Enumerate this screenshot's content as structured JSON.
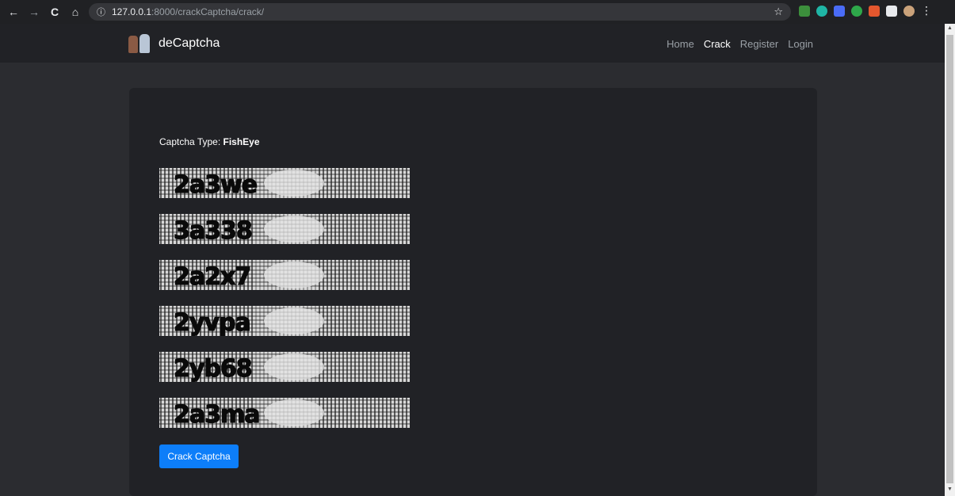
{
  "browser": {
    "url_host": "127.0.0.1",
    "url_path": ":8000/crackCaptcha/crack/",
    "back_icon": "←",
    "forward_icon": "→",
    "reload_icon": "C",
    "home_icon": "⌂",
    "info_icon": "ⓘ",
    "star_icon": "☆",
    "menu_icon": "⋮"
  },
  "navbar": {
    "brand": "deCaptcha",
    "links": [
      {
        "label": "Home",
        "active": false
      },
      {
        "label": "Crack",
        "active": true
      },
      {
        "label": "Register",
        "active": false
      },
      {
        "label": "Login",
        "active": false
      }
    ]
  },
  "content": {
    "captcha_type_label": "Captcha Type: ",
    "captcha_type_value": "FishEye",
    "captchas": [
      "2a3we",
      "3a338",
      "2a2x7",
      "2yvpa",
      "2yb68",
      "2a3ma"
    ],
    "button_label": "Crack Captcha"
  },
  "colors": {
    "page_bg": "#2b2c30",
    "navbar_bg": "#212226",
    "card_bg": "#212226",
    "button_bg": "#0d7ef9"
  }
}
